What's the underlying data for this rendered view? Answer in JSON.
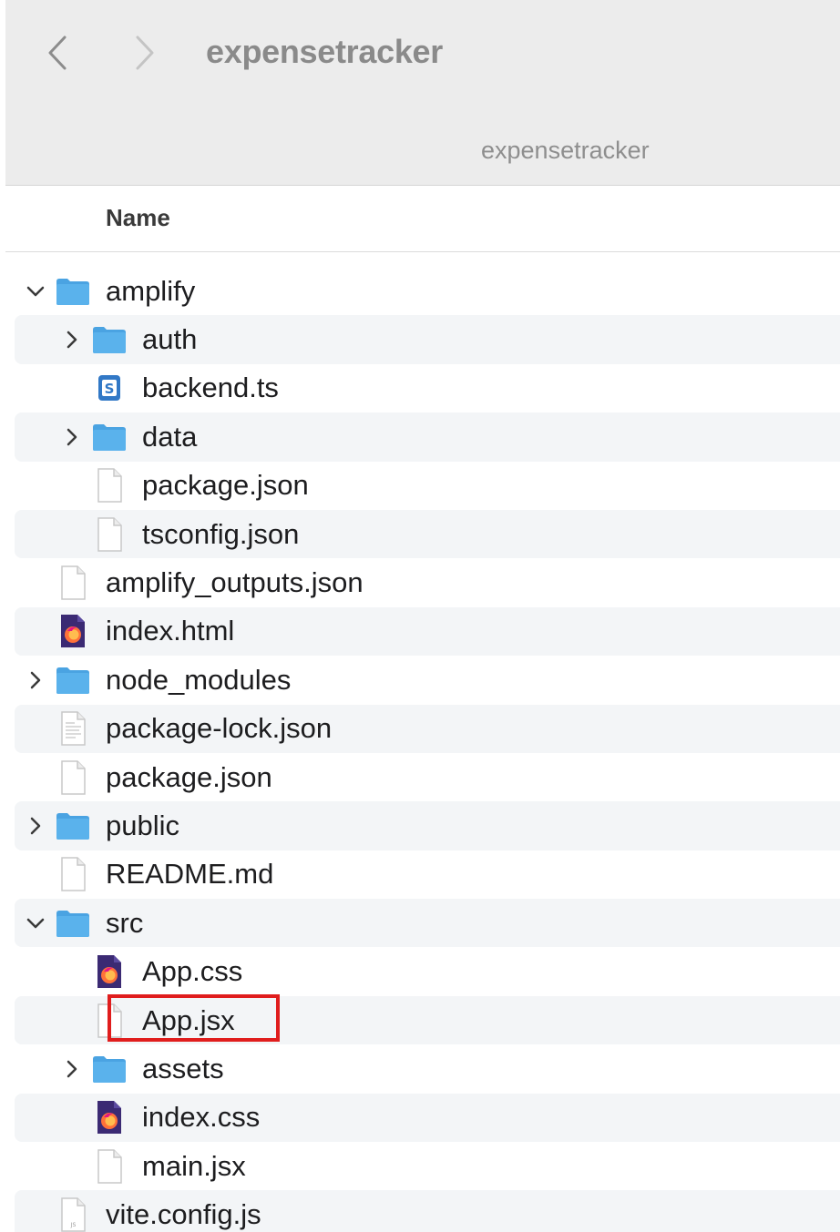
{
  "window": {
    "title": "expensetracker",
    "path_label": "expensetracker"
  },
  "columns": {
    "name": "Name"
  },
  "colors": {
    "folder": "#5ab2ec",
    "selection_box": "#e01d1d",
    "row_alt": "#f3f5f7"
  },
  "items": [
    {
      "name": "amplify",
      "icon": "folder-icon",
      "level": 0,
      "disclosure": "expanded"
    },
    {
      "name": "auth",
      "icon": "folder-icon",
      "level": 1,
      "disclosure": "collapsed"
    },
    {
      "name": "backend.ts",
      "icon": "typescript-file-icon",
      "level": 1,
      "disclosure": "none"
    },
    {
      "name": "data",
      "icon": "folder-icon",
      "level": 1,
      "disclosure": "collapsed"
    },
    {
      "name": "package.json",
      "icon": "blank-file-icon",
      "level": 1,
      "disclosure": "none"
    },
    {
      "name": "tsconfig.json",
      "icon": "blank-file-icon",
      "level": 1,
      "disclosure": "none"
    },
    {
      "name": "amplify_outputs.json",
      "icon": "blank-file-icon",
      "level": 0,
      "disclosure": "none"
    },
    {
      "name": "index.html",
      "icon": "firefox-document-icon",
      "level": 0,
      "disclosure": "none"
    },
    {
      "name": "node_modules",
      "icon": "folder-icon",
      "level": 0,
      "disclosure": "collapsed"
    },
    {
      "name": "package-lock.json",
      "icon": "text-file-icon",
      "level": 0,
      "disclosure": "none"
    },
    {
      "name": "package.json",
      "icon": "blank-file-icon",
      "level": 0,
      "disclosure": "none"
    },
    {
      "name": "public",
      "icon": "folder-icon",
      "level": 0,
      "disclosure": "collapsed"
    },
    {
      "name": "README.md",
      "icon": "blank-file-icon",
      "level": 0,
      "disclosure": "none"
    },
    {
      "name": "src",
      "icon": "folder-icon",
      "level": 0,
      "disclosure": "expanded"
    },
    {
      "name": "App.css",
      "icon": "firefox-document-icon",
      "level": 1,
      "disclosure": "none"
    },
    {
      "name": "App.jsx",
      "icon": "blank-file-icon",
      "level": 1,
      "disclosure": "none"
    },
    {
      "name": "assets",
      "icon": "folder-icon",
      "level": 1,
      "disclosure": "collapsed"
    },
    {
      "name": "index.css",
      "icon": "firefox-document-icon",
      "level": 1,
      "disclosure": "none"
    },
    {
      "name": "main.jsx",
      "icon": "blank-file-icon",
      "level": 1,
      "disclosure": "none"
    },
    {
      "name": "vite.config.js",
      "icon": "js-file-icon",
      "level": 0,
      "disclosure": "none"
    }
  ]
}
